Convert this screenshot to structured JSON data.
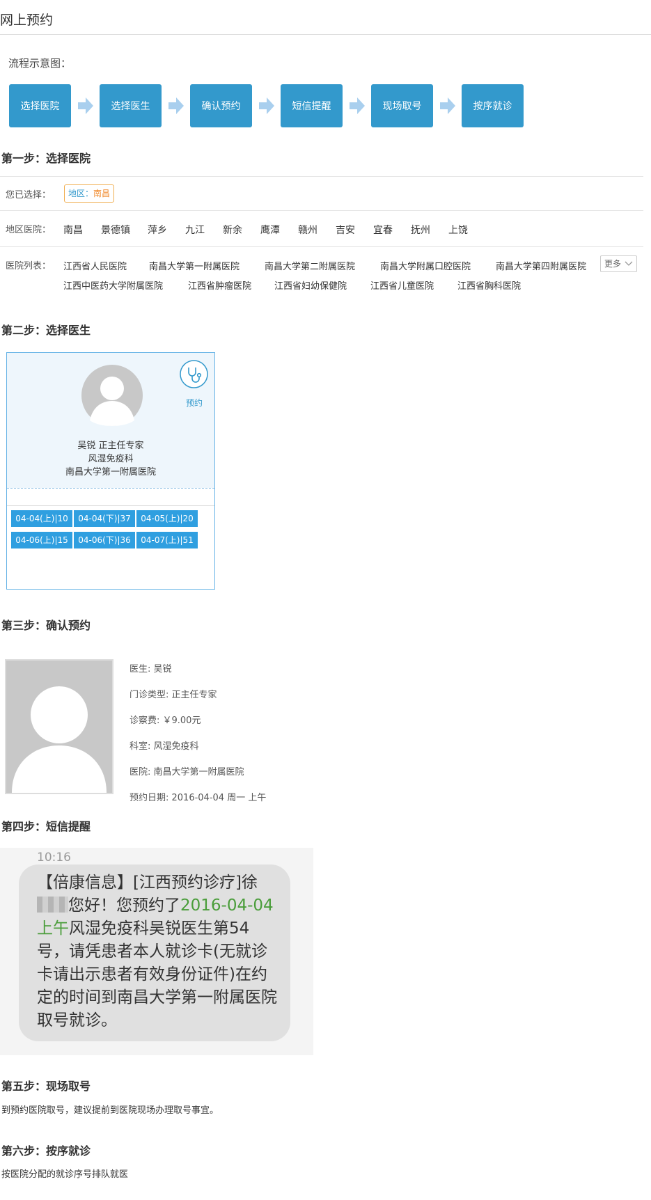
{
  "page_title": "网上预约",
  "flow": {
    "label": "流程示意图：",
    "steps": [
      "选择医院",
      "选择医生",
      "确认预约",
      "短信提醒",
      "现场取号",
      "按序就诊"
    ]
  },
  "step1": {
    "heading": "第一步：选择医院",
    "selected_label": "您已选择：",
    "region_key": "地区：",
    "region_value": "南昌",
    "regions_label": "地区医院：",
    "regions": [
      "南昌",
      "景德镇",
      "萍乡",
      "九江",
      "新余",
      "鹰潭",
      "赣州",
      "吉安",
      "宜春",
      "抚州",
      "上饶"
    ],
    "hospitals_label": "医院列表：",
    "hospitals": [
      "江西省人民医院",
      "南昌大学第一附属医院",
      "南昌大学第二附属医院",
      "南昌大学附属口腔医院",
      "南昌大学第四附属医院",
      "江西中医药大学附属医院",
      "江西省肿瘤医院",
      "江西省妇幼保健院",
      "江西省儿童医院",
      "江西省胸科医院"
    ],
    "more_label": "更多"
  },
  "step2": {
    "heading": "第二步：选择医生",
    "doctor": {
      "name_title": "吴锐 正主任专家",
      "department": "风湿免疫科",
      "hospital": "南昌大学第一附属医院",
      "book_label": "预约"
    },
    "slots": [
      "04-04(上)|10",
      "04-04(下)|37",
      "04-05(上)|20",
      "04-06(上)|15",
      "04-06(下)|36",
      "04-07(上)|51"
    ]
  },
  "step3": {
    "heading": "第三步：确认预约",
    "lines": [
      "医生: 吴锐",
      "门诊类型: 正主任专家",
      "诊察费: ￥9.00元",
      "科室: 风湿免疫科",
      "医院: 南昌大学第一附属医院",
      "预约日期: 2016-04-04 周一 上午"
    ]
  },
  "step4": {
    "heading": "第四步：短信提醒",
    "sms_time": "10:16",
    "sms_part1": "【倍康信息】[江西预约诊疗]徐",
    "sms_part2": "您好！您预约了",
    "sms_date": "2016-04-04上午",
    "sms_part3": "风湿免疫科吴锐医生第54号，请凭患者本人就诊卡(无就诊卡请出示患者有效身份证件)在约定的时间到南昌大学第一附属医院取号就诊。"
  },
  "step5": {
    "heading": "第五步：现场取号",
    "text": "到预约医院取号，建议提前到医院现场办理取号事宜。"
  },
  "step6": {
    "heading": "第六步：按序就诊",
    "text": "按医院分配的就诊序号排队就医"
  },
  "colors": {
    "accent": "#3399cc",
    "slot": "#2f9fe0",
    "region_tag": "#f0892b",
    "sms_date": "#4a9d3a"
  }
}
